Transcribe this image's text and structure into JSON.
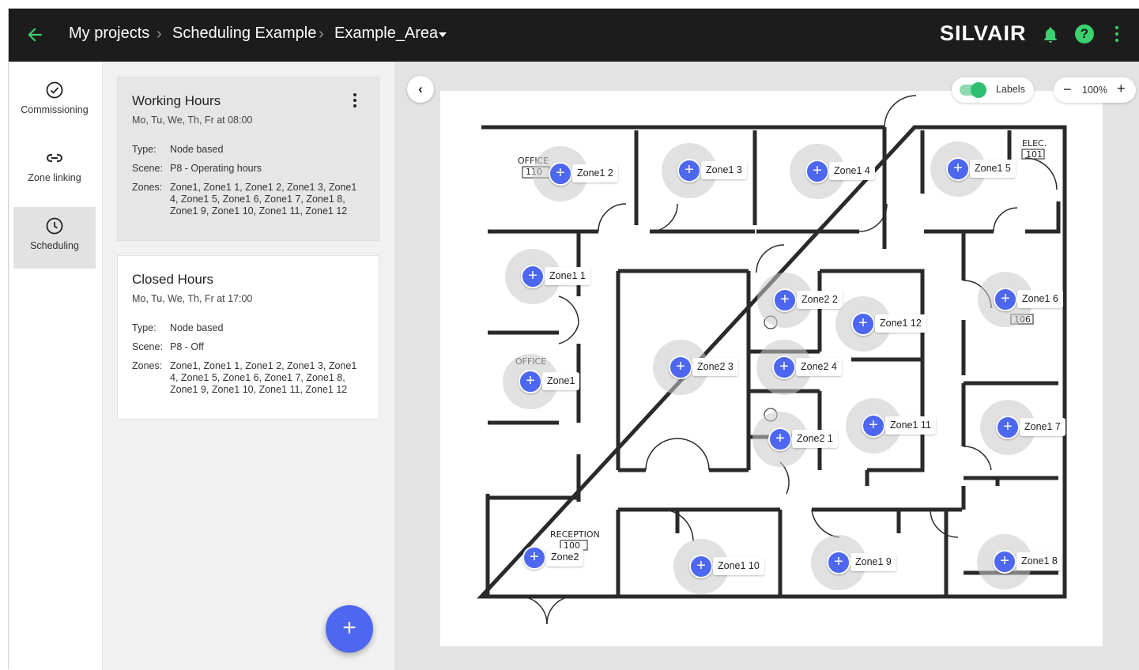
{
  "breadcrumb": {
    "root": "My projects",
    "project": "Scheduling Example",
    "area": "Example_Area"
  },
  "brand": "SILVAIR",
  "sidebar": {
    "items": [
      {
        "label": "Commissioning",
        "icon": "check-circle-icon"
      },
      {
        "label": "Zone linking",
        "icon": "link-icon"
      },
      {
        "label": "Scheduling",
        "icon": "clock-icon",
        "active": true
      }
    ]
  },
  "schedules": [
    {
      "title": "Working Hours",
      "subtitle": "Mo, Tu, We, Th, Fr at 08:00",
      "type_label": "Type:",
      "type": "Node based",
      "scene_label": "Scene:",
      "scene": "P8 - Operating hours",
      "zones_label": "Zones:",
      "zones": "Zone1, Zone1 1, Zone1 2, Zone1 3, Zone1 4, Zone1 5, Zone1 6, Zone1 7, Zone1 8, Zone1 9, Zone1 10, Zone1 11, Zone1 12"
    },
    {
      "title": "Closed Hours",
      "subtitle": "Mo, Tu, We, Th, Fr at 17:00",
      "type_label": "Type:",
      "type": "Node based",
      "scene_label": "Scene:",
      "scene": "P8 - Off",
      "zones_label": "Zones:",
      "zones": "Zone1, Zone1 1, Zone1 2, Zone1 3, Zone1 4, Zone1 5, Zone1 6, Zone1 7, Zone1 8, Zone1 9, Zone1 10, Zone1 11, Zone1 12"
    }
  ],
  "map_controls": {
    "labels_toggle": "Labels",
    "labels_on": true,
    "zoom": "100%"
  },
  "room_labels": {
    "office": "OFFICE",
    "office_110": "110",
    "elec": "ELEC.",
    "elec_101": "101",
    "office_106": "106",
    "reception": "RECEPTION",
    "reception_100": "100"
  },
  "zones": [
    "Zone1 2",
    "Zone1 3",
    "Zone1 4",
    "Zone1 5",
    "Zone1 1",
    "Zone2 2",
    "Zone1 6",
    "Zone1 12",
    "Zone2 3",
    "Zone2 4",
    "Zone1",
    "Zone2 1",
    "Zone1 11",
    "Zone1 7",
    "Zone2",
    "Zone1 10",
    "Zone1 9",
    "Zone1 8"
  ],
  "colors": {
    "topbar": "#1c1c1c",
    "accent_green": "#3bd16f",
    "zone_blue": "#4d67f0",
    "panel_bg": "#f1f1f1",
    "map_bg": "#e3e3e3"
  }
}
